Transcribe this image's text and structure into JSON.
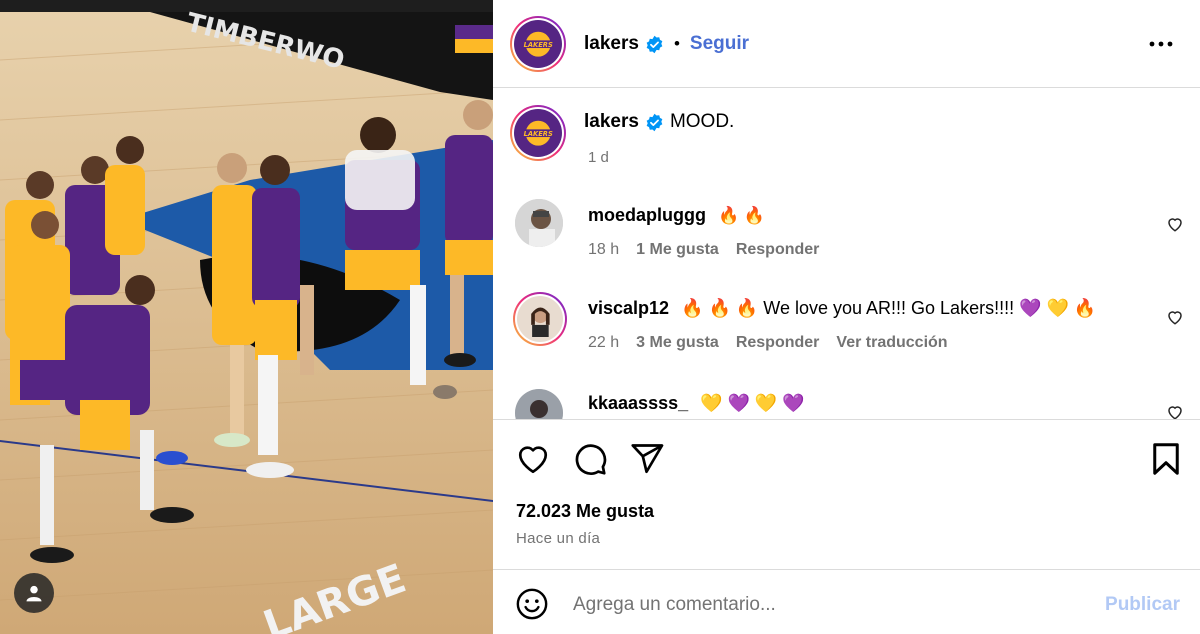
{
  "post": {
    "author": "lakers",
    "follow_label": "Seguir",
    "separator": "•",
    "more_icon": "more-horizontal-icon",
    "caption_user": "lakers",
    "caption_text": "MOOD.",
    "caption_time": "1 d"
  },
  "comments": [
    {
      "user": "moedapluggg",
      "text": "🔥 🔥",
      "time": "18 h",
      "likes": "1 Me gusta",
      "reply": "Responder",
      "translate": ""
    },
    {
      "user": "viscalp12",
      "text": "🔥 🔥 🔥 We love you AR!!! Go Lakers!!!! 💜 💛 🔥",
      "time": "22 h",
      "likes": "3 Me gusta",
      "reply": "Responder",
      "translate": "Ver traducción"
    },
    {
      "user": "kkaaassss_",
      "text": "💛 💜 💛 💜",
      "time": "",
      "likes": "",
      "reply": "",
      "translate": ""
    }
  ],
  "actions": {
    "like_icon": "heart-icon",
    "comment_icon": "comment-bubble-icon",
    "share_icon": "send-icon",
    "save_icon": "bookmark-icon",
    "likes_count": "72.023 Me gusta",
    "posted_ago": "Hace un día"
  },
  "composer": {
    "placeholder": "Agrega un comentario...",
    "publish_label": "Publicar",
    "emoji_icon": "smiley-icon"
  },
  "colors": {
    "lakers_purple": "#552583",
    "lakers_gold": "#FDB927",
    "link_blue": "#4a6fd3",
    "publish_disabled": "#b2c9f5",
    "verified_blue": "#0095f6"
  }
}
